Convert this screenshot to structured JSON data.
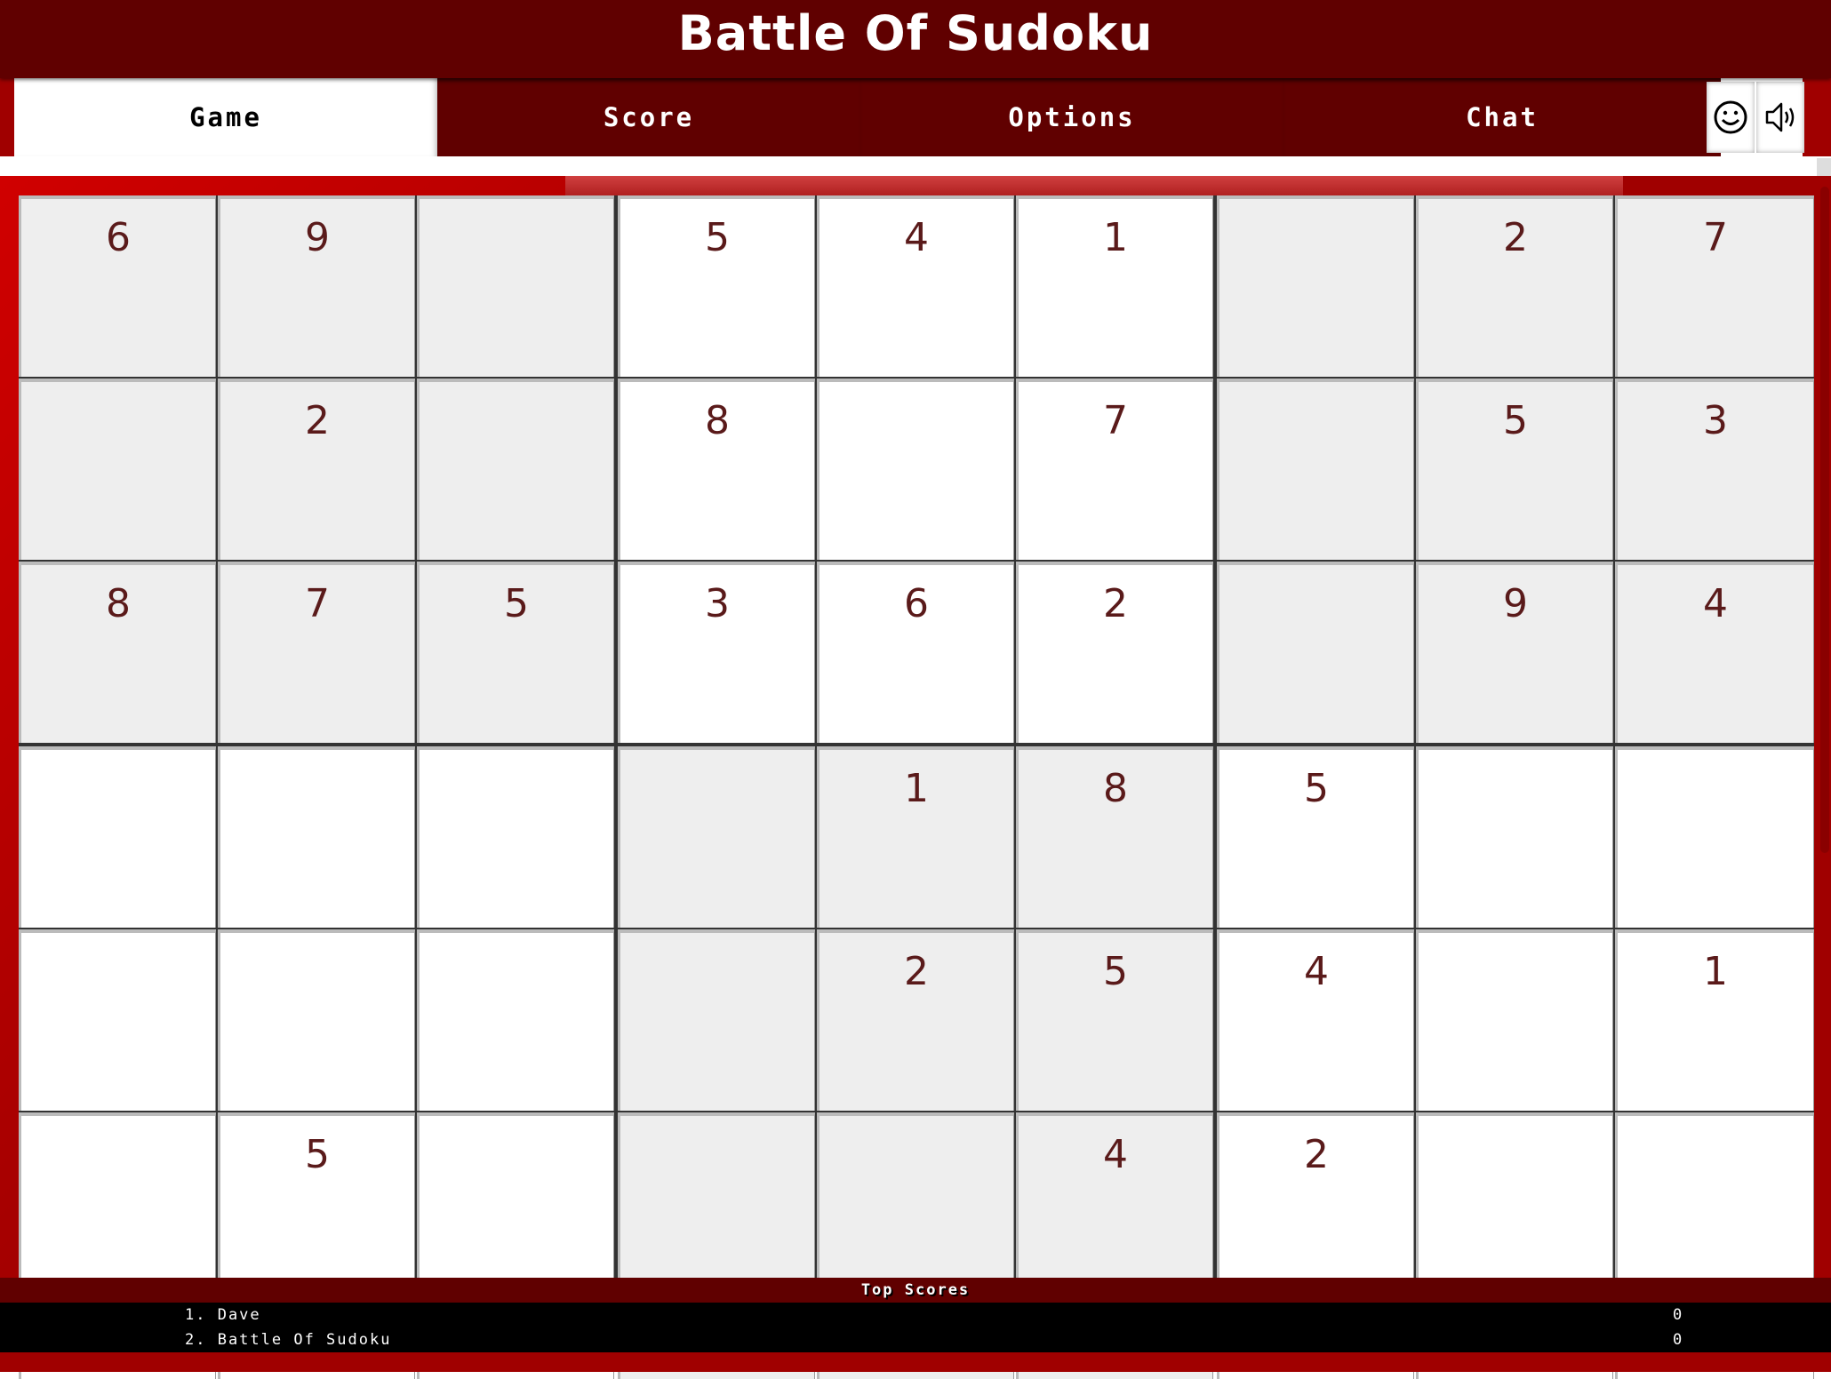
{
  "app": {
    "title": "Battle Of Sudoku"
  },
  "tabs": [
    {
      "label": "Game",
      "active": true
    },
    {
      "label": "Score",
      "active": false
    },
    {
      "label": "Options",
      "active": false
    },
    {
      "label": "Chat",
      "active": false
    }
  ],
  "toolbar": {
    "emoji_icon": "☺",
    "sound_icon": "sound-on"
  },
  "colors": {
    "brand": "#600000",
    "frame": "#a00000",
    "digit": "#5a1a1a",
    "given_shade": "#eeeeee"
  },
  "board": {
    "rows": [
      [
        "6",
        "9",
        "",
        "5",
        "4",
        "1",
        "",
        "2",
        "7"
      ],
      [
        "",
        "2",
        "",
        "8",
        "",
        "7",
        "",
        "5",
        "3"
      ],
      [
        "8",
        "7",
        "5",
        "3",
        "6",
        "2",
        "",
        "9",
        "4"
      ],
      [
        "",
        "",
        "",
        "",
        "1",
        "8",
        "5",
        "",
        ""
      ],
      [
        "",
        "",
        "",
        "",
        "2",
        "5",
        "4",
        "",
        "1"
      ],
      [
        "",
        "5",
        "",
        "",
        "",
        "4",
        "2",
        "",
        ""
      ]
    ]
  },
  "top_scores": {
    "title": "Top Scores",
    "entries": [
      {
        "name": "1. Dave",
        "score": "0"
      },
      {
        "name": "2. Battle Of Sudoku",
        "score": "0"
      }
    ]
  }
}
